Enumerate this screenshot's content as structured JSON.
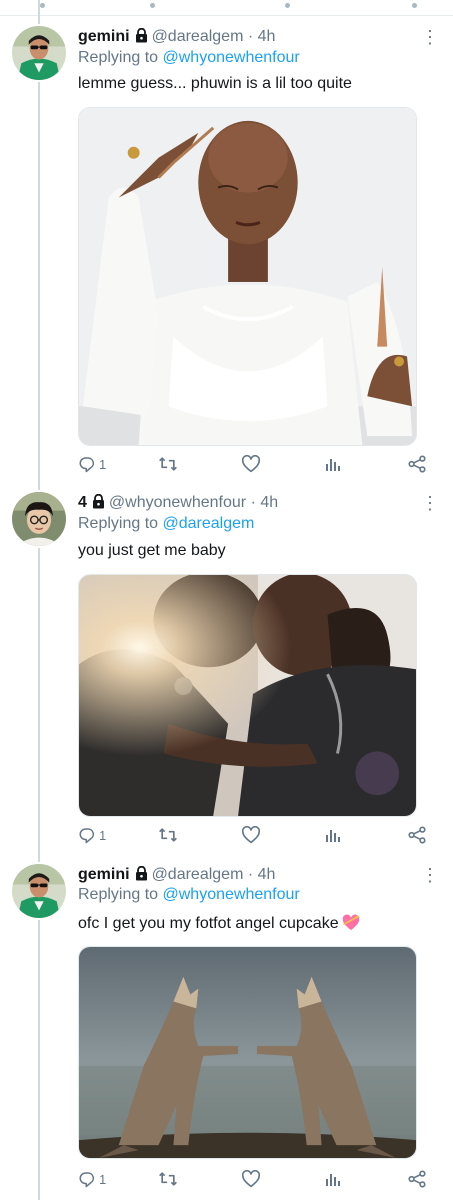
{
  "tweets": [
    {
      "author": {
        "name": "gemini",
        "handle": "@darealgem",
        "time": "4h",
        "avatar": "green-jacket-sunglasses"
      },
      "reply_prefix": "Replying to",
      "reply_to": "@whyonewhenfour",
      "text": "lemme guess... phuwin is a lil too quite",
      "media": "bald-woman-white-feather-dress-long-nails",
      "reply_count": "1",
      "more_icon": "more-vertical-icon"
    },
    {
      "author": {
        "name": "4",
        "handle": "@whyonewhenfour",
        "time": "4h",
        "avatar": "boy-with-glasses"
      },
      "reply_prefix": "Replying to",
      "reply_to": "@darealgem",
      "text": "you just get me baby",
      "media": "two-men-forehead-touch-lens-flare",
      "reply_count": "1",
      "more_icon": "more-vertical-icon"
    },
    {
      "author": {
        "name": "gemini",
        "handle": "@darealgem",
        "time": "4h",
        "avatar": "green-jacket-sunglasses"
      },
      "reply_prefix": "Replying to",
      "reply_to": "@whyonewhenfour",
      "text": "ofc I get you my fotfot angel cupcake",
      "emoji": "heart-with-ribbon",
      "media": "two-wolves-holding-paws",
      "reply_count": "1",
      "more_icon": "more-vertical-icon"
    }
  ],
  "time_separator": "·",
  "colors": {
    "link": "#1da1f2",
    "muted": "#657786",
    "text": "#14171a",
    "thread_line": "#cfd9de"
  }
}
